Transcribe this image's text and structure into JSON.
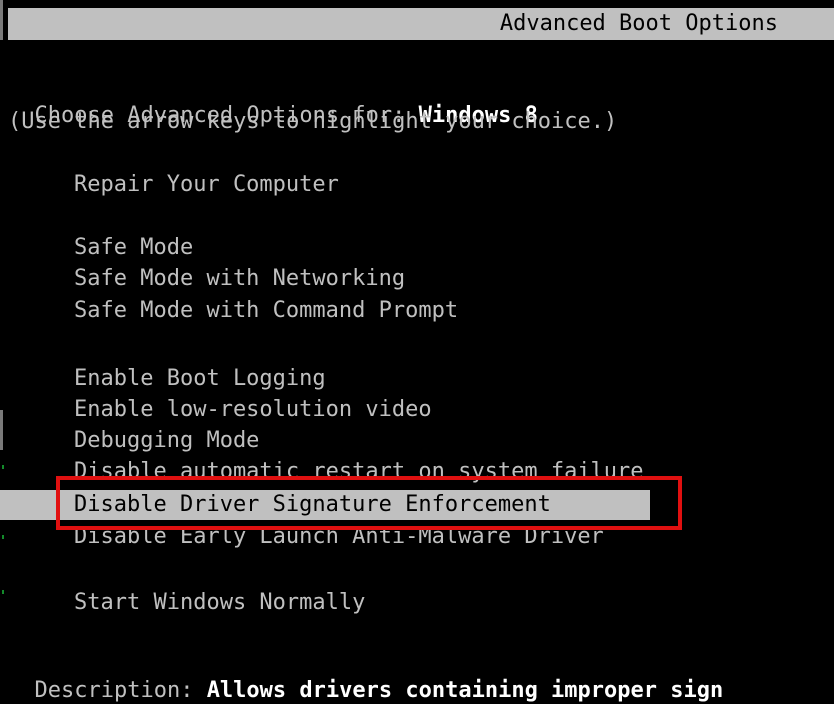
{
  "header": {
    "title": "Advanced Boot Options"
  },
  "intro": {
    "choose_label": "Choose Advanced Options for: ",
    "os_name": "Windows 8",
    "hint": "(Use the arrow keys to highlight your choice.)"
  },
  "menu": {
    "repair": "Repair Your Computer",
    "safe_mode": "Safe Mode",
    "safe_mode_networking": "Safe Mode with Networking",
    "safe_mode_cmd": "Safe Mode with Command Prompt",
    "boot_logging": "Enable Boot Logging",
    "low_res": "Enable low-resolution video",
    "debugging": "Debugging Mode",
    "disable_restart": "Disable automatic restart on system failure",
    "disable_driver_sig": "Disable Driver Signature Enforcement",
    "disable_elam": "Disable Early Launch Anti-Malware Driver",
    "start_normally": "Start Windows Normally"
  },
  "description": {
    "label": "Description: ",
    "text": "Allows drivers containing improper sign"
  },
  "colors": {
    "background": "#000000",
    "text": "#c0c0c0",
    "highlight": "#c0c0c0",
    "callout_border": "#e01010"
  }
}
